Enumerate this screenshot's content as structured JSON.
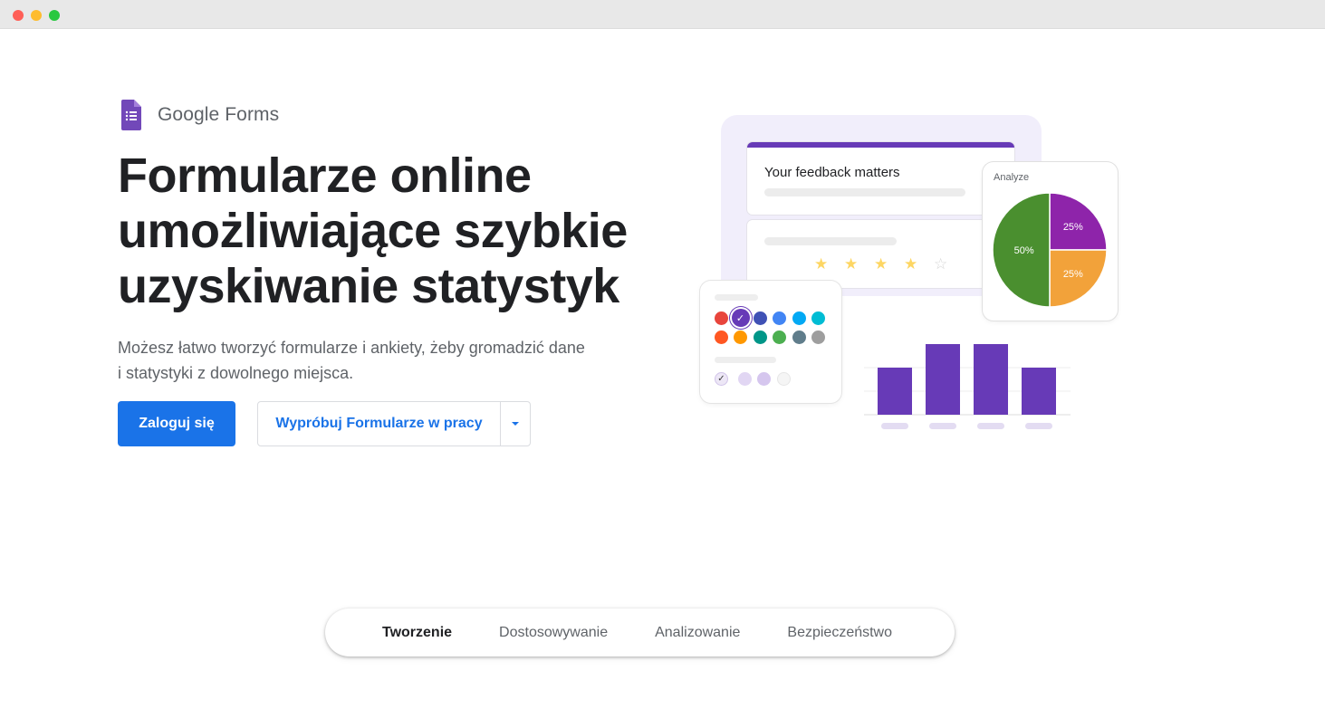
{
  "window": {
    "controls": [
      "close",
      "minimize",
      "maximize"
    ]
  },
  "brand": {
    "name": "Google Forms",
    "icon": "google-forms-icon",
    "icon_color": "#7248b9"
  },
  "hero": {
    "headline_lines": [
      "Formularze online",
      "umożliwiające szybkie",
      "uzyskiwanie statystyk"
    ],
    "subtext_lines": [
      "Możesz łatwo tworzyć formularze i ankiety, żeby gromadzić dane",
      "i statystyki z dowolnego miejsca."
    ],
    "primary_button": "Zaloguj się",
    "secondary_button": "Wypróbuj Formularze w pracy",
    "secondary_dropdown_icon": "caret-down-icon"
  },
  "illustration": {
    "form_title": "Your feedback matters",
    "rating": {
      "value": 4,
      "max": 5
    },
    "pie": {
      "label": "Analyze",
      "slices": [
        {
          "label": "25%",
          "value": 25,
          "color": "#8e24aa"
        },
        {
          "label": "25%",
          "value": 25,
          "color": "#f2a23a"
        },
        {
          "label": "50%",
          "value": 50,
          "color": "#4a8f2f"
        }
      ]
    },
    "palette_colors": [
      "#e8453c",
      "#673ab7",
      "#3f51b5",
      "#4285f4",
      "#03a9f4",
      "#00bcd4",
      "#ff5722",
      "#ff9800",
      "#009688",
      "#4caf50",
      "#607d8b",
      "#9e9e9e"
    ],
    "selected_color_index": 1,
    "bars": {
      "values": [
        2,
        3,
        3,
        2
      ],
      "color": "#673ab7"
    }
  },
  "colors": {
    "accent": "#1a73e8",
    "brand_purple": "#673ab7"
  },
  "tabs": [
    {
      "label": "Tworzenie",
      "active": true
    },
    {
      "label": "Dostosowywanie",
      "active": false
    },
    {
      "label": "Analizowanie",
      "active": false
    },
    {
      "label": "Bezpieczeństwo",
      "active": false
    }
  ]
}
